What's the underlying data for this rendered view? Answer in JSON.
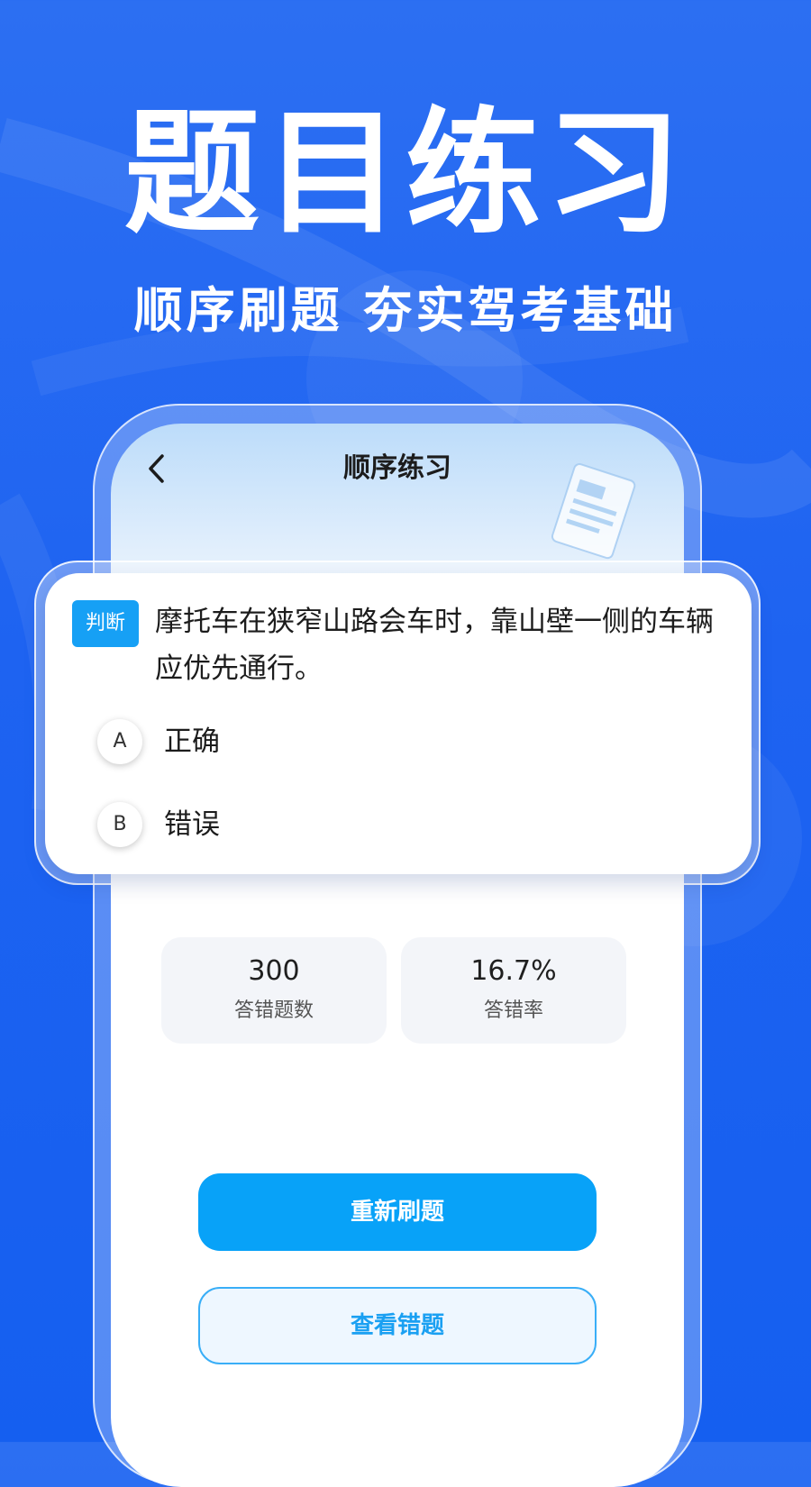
{
  "hero": {
    "title": "题目练习",
    "subtitle": "顺序刷题 夯实驾考基础"
  },
  "screen": {
    "title": "顺序练习"
  },
  "question": {
    "type_label": "判断",
    "text": "摩托车在狭窄山路会车时，靠山壁一侧的车辆应优先通行。",
    "options": [
      {
        "letter": "A",
        "text": "正确"
      },
      {
        "letter": "B",
        "text": "错误"
      }
    ]
  },
  "stats": [
    {
      "value": "300",
      "label": "答错题数"
    },
    {
      "value": "16.7%",
      "label": "答错率"
    }
  ],
  "buttons": {
    "redo_label": "重新刷题",
    "review_label": "查看错题"
  },
  "colors": {
    "background": "#1e63f1",
    "primary_button": "#08a2f8",
    "secondary_border": "#39aef7",
    "tag": "#16a0f5"
  },
  "icons": {
    "back": "chevron-left-icon",
    "document": "document-illustration-icon"
  }
}
